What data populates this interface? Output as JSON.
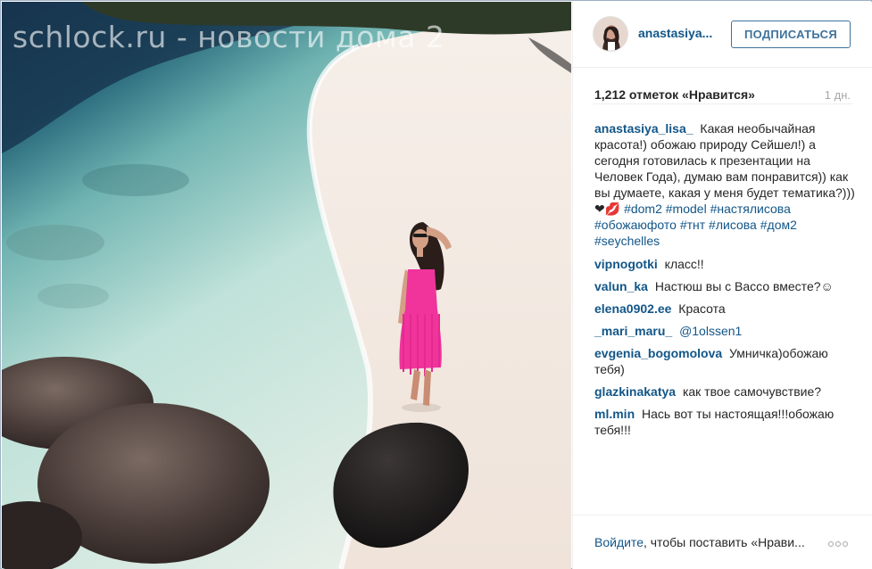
{
  "photo": {
    "watermark": "schlock.ru - новости дома 2"
  },
  "header": {
    "username": "anastasiya...",
    "follow_label": "ПОДПИСАТЬСЯ"
  },
  "stats": {
    "likes": "1,212 отметок «Нравится»",
    "time_ago": "1 дн."
  },
  "caption": {
    "author": "anastasiya_lisa_",
    "text": "Какая необычайная красота!) обожаю природу Сейшел!) а сегодня готовилась к презентации на Человек Года), думаю вам понравится)) как вы думаете, какая у меня будет тематика?)))❤💋",
    "tags": [
      "#dom2",
      "#model",
      "#настялисова",
      "#обожаюфото",
      "#тнт",
      "#лисова",
      "#дом2",
      "#seychelles"
    ]
  },
  "comments": [
    {
      "author": "vipnogotki",
      "text": "класс!!"
    },
    {
      "author": "valun_ka",
      "text": "Настюш вы с Вассо вместе?☺"
    },
    {
      "author": "elena0902.ee",
      "text": "Красота"
    },
    {
      "author": "_mari_maru_",
      "text": "",
      "mention": "@1olssen1"
    },
    {
      "author": "evgenia_bogomolova",
      "text": "Умничка)обожаю тебя)"
    },
    {
      "author": "glazkinakatya",
      "text": "как твое самочувствие?"
    },
    {
      "author": "ml.min",
      "text": "Нась вот ты настоящая!!!обожаю тебя!!!"
    }
  ],
  "footer": {
    "login_link": "Войдите",
    "login_rest": ", чтобы поставить «Нрави..."
  },
  "colors": {
    "link": "#125688",
    "follow_border": "#3f729b",
    "pink_dress": "#f0349c"
  },
  "icons": {
    "more": "more-options-icon"
  }
}
